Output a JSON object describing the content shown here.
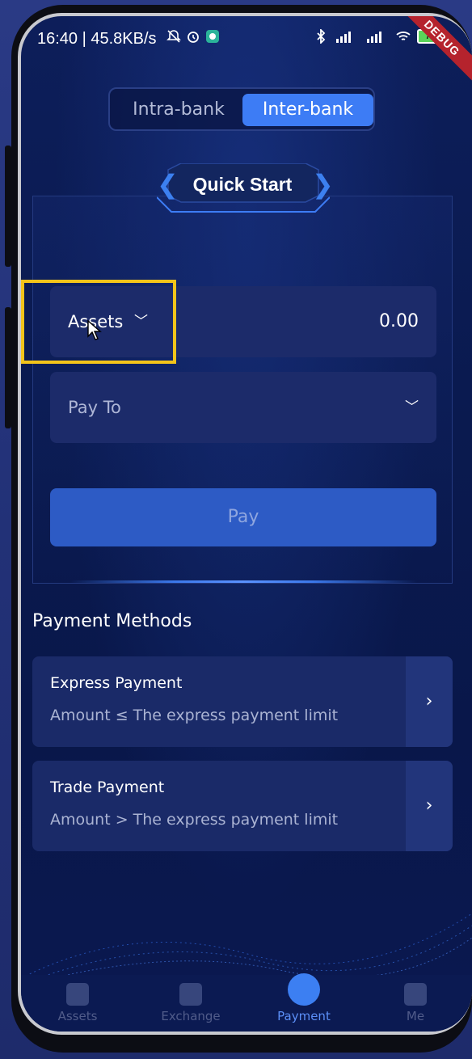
{
  "status_bar": {
    "time": "16:40",
    "speed": "| 45.8KB/s",
    "battery_level": "74",
    "debug_label": "DEBUG"
  },
  "segment": {
    "intra_label": "Intra-bank",
    "inter_label": "Inter-bank",
    "selected": "Inter-bank"
  },
  "quick_start": {
    "title": "Quick Start",
    "assets_label": "Assets",
    "assets_value": "0.00",
    "pay_to_label": "Pay To",
    "pay_button_label": "Pay"
  },
  "payment_methods": {
    "title": "Payment Methods",
    "items": [
      {
        "name": "Express Payment",
        "desc": "Amount ≤ The express payment limit"
      },
      {
        "name": "Trade Payment",
        "desc": "Amount > The express payment limit"
      }
    ]
  },
  "bottom_nav": {
    "items": [
      {
        "label": "Assets",
        "icon": "wallet-icon"
      },
      {
        "label": "Exchange",
        "icon": "exchange-icon"
      },
      {
        "label": "Payment",
        "icon": "payment-icon"
      },
      {
        "label": "Me",
        "icon": "user-icon"
      }
    ],
    "active": "Payment"
  },
  "colors": {
    "accent": "#3d7cf5",
    "highlight": "#f3c41a",
    "debug": "#b5232d"
  }
}
